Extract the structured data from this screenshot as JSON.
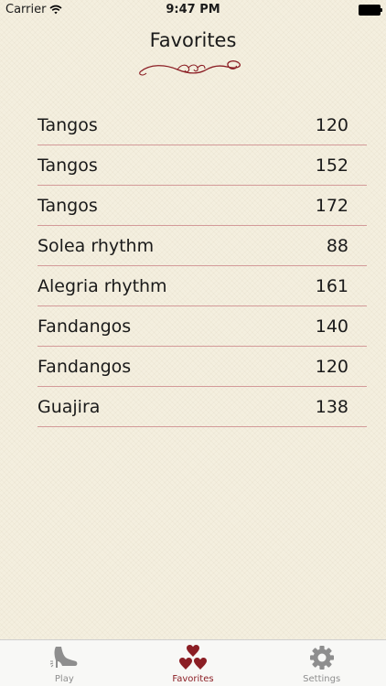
{
  "status_bar": {
    "carrier": "Carrier",
    "time": "9:47 PM"
  },
  "header": {
    "title": "Favorites"
  },
  "favorites": [
    {
      "name": "Tangos",
      "bpm": "120"
    },
    {
      "name": "Tangos",
      "bpm": "152"
    },
    {
      "name": "Tangos",
      "bpm": "172"
    },
    {
      "name": "Solea rhythm",
      "bpm": "88"
    },
    {
      "name": "Alegria rhythm",
      "bpm": "161"
    },
    {
      "name": "Fandangos",
      "bpm": "140"
    },
    {
      "name": "Fandangos",
      "bpm": "120"
    },
    {
      "name": "Guajira",
      "bpm": "138"
    }
  ],
  "tab_bar": {
    "tabs": [
      {
        "label": "Play",
        "icon": "shoe-icon"
      },
      {
        "label": "Favorites",
        "icon": "hearts-icon"
      },
      {
        "label": "Settings",
        "icon": "gear-icon"
      }
    ],
    "active": "Favorites"
  },
  "colors": {
    "accent": "#8b1e24",
    "divider": "#d39a99",
    "background": "#f4efdf",
    "inactive_tab": "#8e8e8e"
  }
}
